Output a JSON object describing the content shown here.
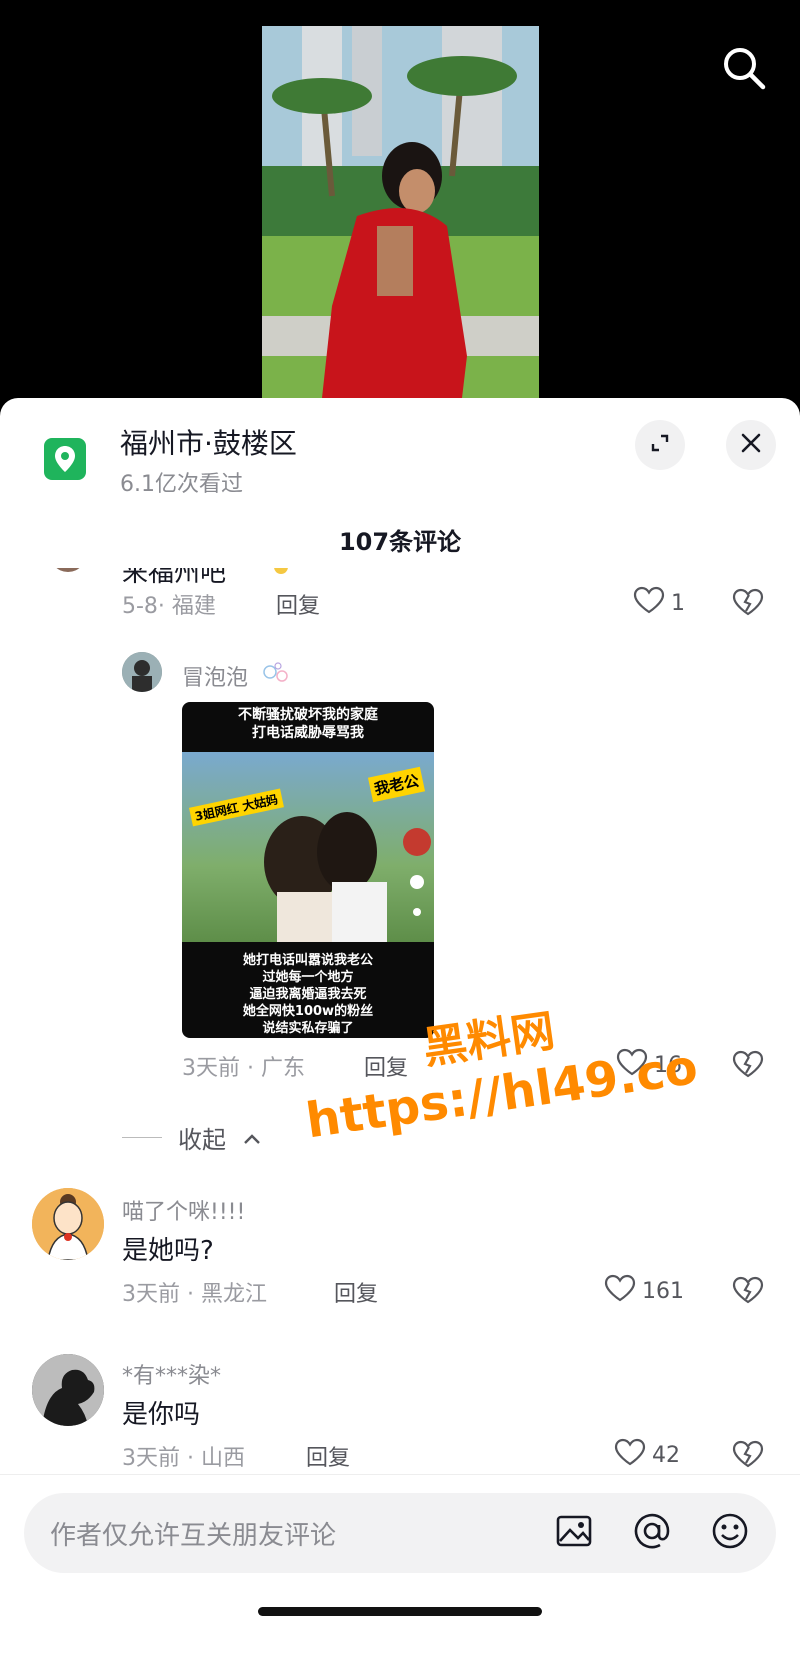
{
  "location": {
    "title": "福州市·鼓楼区",
    "views": "6.1亿次看过"
  },
  "comments_count": "107条评论",
  "comments": [
    {
      "partial_text": "来福州吧",
      "meta": "5-8· 福建",
      "reply": "回复",
      "likes": "1"
    },
    {
      "username": "冒泡泡",
      "image_lines": [
        "不断骚扰破坏我的家庭",
        "打电话威胁辱骂我",
        "我老公",
        "3姐网红 大姑妈",
        "她打电话叫嚣说我老公",
        "过她每一个地方",
        "逼迫我离婚逼我去死",
        "她全网快100w的粉丝",
        "说结实私存骗了"
      ],
      "meta": "3天前 · 广东",
      "reply": "回复",
      "likes": "16"
    },
    {
      "collapse": "收起"
    },
    {
      "username": "喵了个咪!!!!",
      "text": "是她吗?",
      "meta": "3天前 · 黑龙江",
      "reply": "回复",
      "likes": "161"
    },
    {
      "username": "*有***染*",
      "text": "是你吗",
      "meta": "3天前 · 山西",
      "reply": "回复",
      "likes": "42"
    }
  ],
  "input": {
    "placeholder": "作者仅允许互关朋友评论"
  },
  "watermark": {
    "line1": "黑料网",
    "line2": "https://hl49.co"
  },
  "icons": [
    "search-icon",
    "location-icon",
    "expand-icon",
    "close-icon",
    "heart-icon",
    "dislike-icon",
    "image-icon",
    "at-icon",
    "emoji-icon"
  ],
  "colors": {
    "accent_green": "#1fb45c",
    "watermark": "#ff8a00"
  }
}
